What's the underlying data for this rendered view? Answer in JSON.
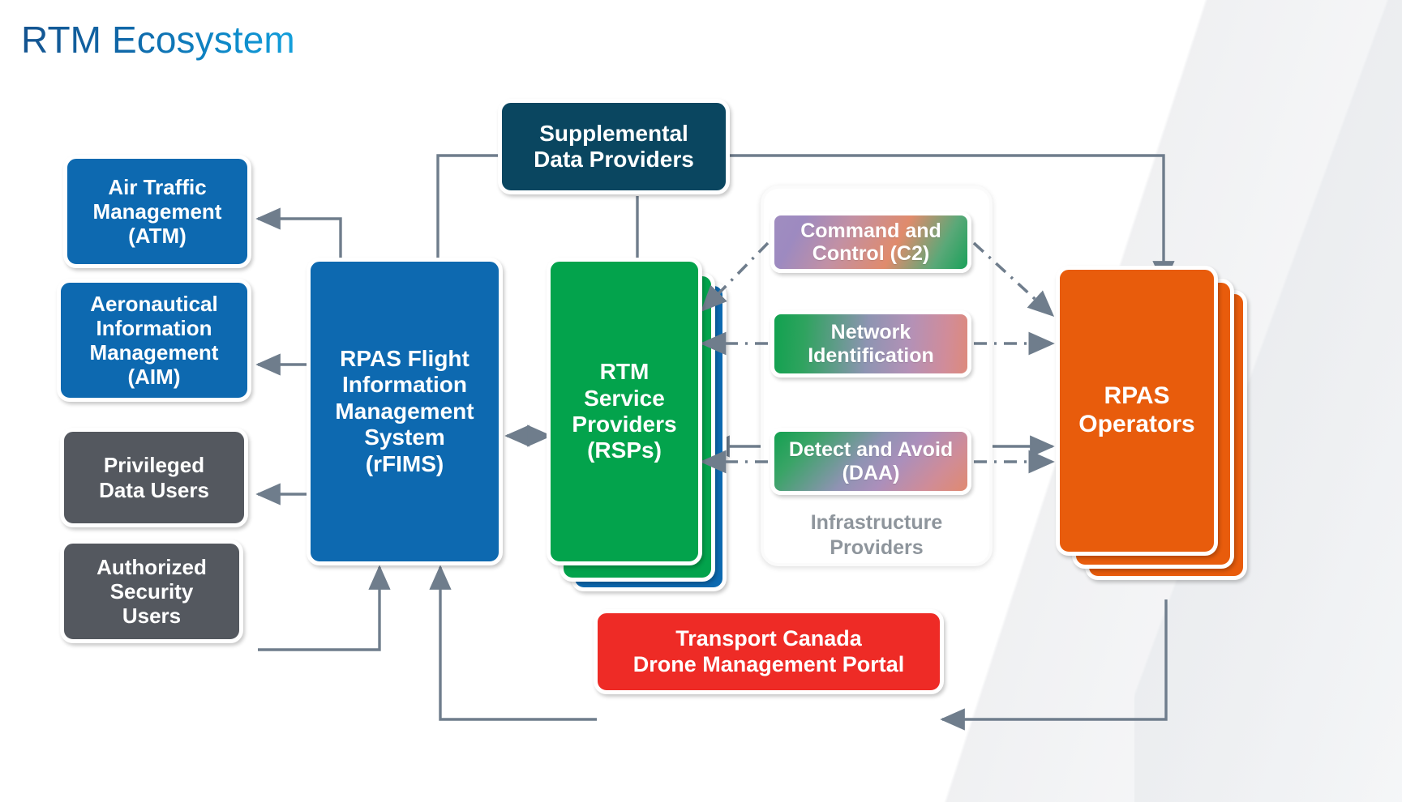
{
  "slide": {
    "title": "RTM Ecosystem",
    "background_color": "#ffffff"
  },
  "palette": {
    "blue": "#0d69b0",
    "grey": "#54585f",
    "navy": "#0a4660",
    "green": "#03a34c",
    "orange": "#e85c0c",
    "red": "#ee2b26",
    "connector": "#6f7d8c",
    "infra_label": "#8e959c",
    "title_gradient_from": "#14538f",
    "title_gradient_to": "#14a0dc"
  },
  "nodes": {
    "atm": {
      "label": "Air Traffic\nManagement\n(ATM)",
      "line1": "Air Traffic",
      "line2": "Management",
      "line3": "(ATM)",
      "color": "#0d69b0"
    },
    "aim": {
      "label": "Aeronautical\nInformation\nManagement\n(AIM)",
      "line1": "Aeronautical",
      "line2": "Information",
      "line3": "Management",
      "line4": "(AIM)",
      "color": "#0d69b0"
    },
    "privileged": {
      "line1": "Privileged",
      "line2": "Data Users",
      "color": "#54585f"
    },
    "security": {
      "line1": "Authorized",
      "line2": "Security",
      "line3": "Users",
      "color": "#54585f"
    },
    "rfims": {
      "line1": "RPAS Flight",
      "line2": "Information",
      "line3": "Management",
      "line4": "System",
      "line5": "(rFIMS)",
      "color": "#0d69b0"
    },
    "supplemental": {
      "line1": "Supplemental",
      "line2": "Data Providers",
      "color": "#0a4660"
    },
    "rsp": {
      "line1": "RTM",
      "line2": "Service",
      "line3": "Providers",
      "line4": "(RSPs)",
      "color": "#03a34c",
      "stack_layers": 3
    },
    "operators": {
      "line1": "RPAS",
      "line2": "Operators",
      "color": "#e85c0c",
      "stack_layers": 3
    },
    "portal": {
      "line1": "Transport Canada",
      "line2": "Drone Management Portal",
      "color": "#ee2b26"
    }
  },
  "infrastructure": {
    "group_label_line1": "Infrastructure",
    "group_label_line2": "Providers",
    "items": [
      {
        "id": "c2",
        "line1": "Command and",
        "line2": "Control (C2)"
      },
      {
        "id": "netid",
        "line1": "Network",
        "line2": "Identification"
      },
      {
        "id": "daa",
        "line1": "Detect and",
        "line2": "Avoid (DAA)"
      }
    ]
  },
  "connectors": [
    {
      "from": "rfims",
      "to": "atm",
      "style": "solid",
      "arrow": "end"
    },
    {
      "from": "rfims",
      "to": "aim",
      "style": "solid",
      "arrow": "end"
    },
    {
      "from": "rfims",
      "to": "privileged",
      "style": "solid",
      "arrow": "end"
    },
    {
      "from": "security",
      "to": "rfims",
      "style": "solid",
      "arrow": "end"
    },
    {
      "from": "supplemental",
      "to": "rfims",
      "style": "solid",
      "arrow": "end"
    },
    {
      "from": "supplemental",
      "to": "rsp",
      "style": "solid",
      "arrow": "end"
    },
    {
      "from": "supplemental",
      "to": "operators",
      "style": "solid",
      "arrow": "end"
    },
    {
      "from": "rfims",
      "to": "rsp",
      "style": "solid",
      "arrow": "both"
    },
    {
      "from": "rsp",
      "to": "operators",
      "style": "solid",
      "arrow": "both"
    },
    {
      "from": "portal",
      "to": "rfims",
      "style": "solid",
      "arrow": "end"
    },
    {
      "from": "operators",
      "to": "portal",
      "style": "solid",
      "arrow": "end"
    },
    {
      "from": "c2",
      "to": "rsp",
      "style": "dash-dot",
      "arrow": "end"
    },
    {
      "from": "c2",
      "to": "operators",
      "style": "dash-dot",
      "arrow": "end"
    },
    {
      "from": "netid",
      "to": "rsp",
      "style": "dash-dot",
      "arrow": "end"
    },
    {
      "from": "netid",
      "to": "operators",
      "style": "dash-dot",
      "arrow": "end"
    },
    {
      "from": "daa",
      "to": "rsp",
      "style": "dash-dot",
      "arrow": "end"
    },
    {
      "from": "daa",
      "to": "operators",
      "style": "dash-dot",
      "arrow": "end"
    }
  ]
}
